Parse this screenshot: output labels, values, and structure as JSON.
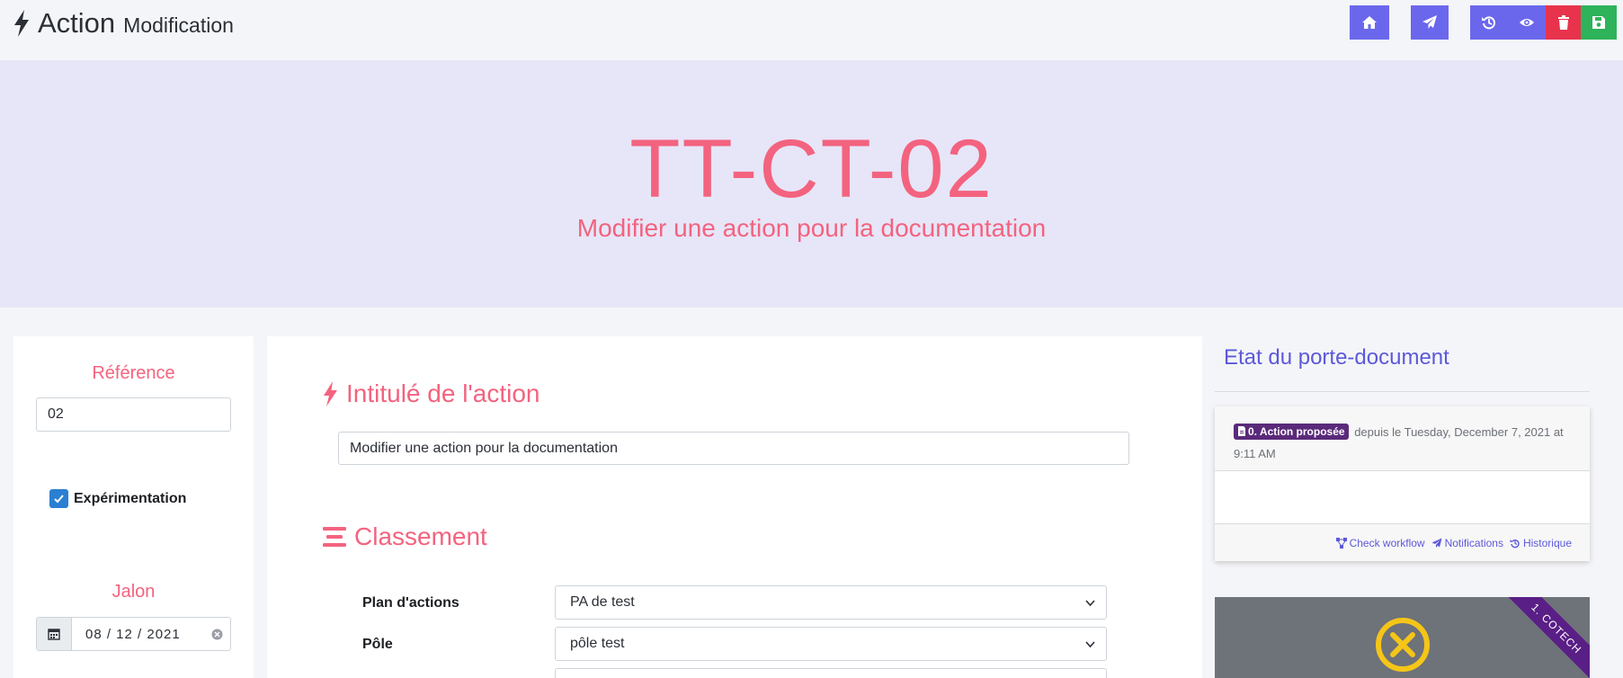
{
  "header": {
    "title": "Action",
    "subtitle": "Modification",
    "icons": [
      "bolt-icon",
      "home-icon",
      "paper-plane-icon",
      "history-icon",
      "eye-icon",
      "trash-icon",
      "save-icon"
    ]
  },
  "hero": {
    "code": "TT-CT-02",
    "subtitle": "Modifier une action pour la documentation"
  },
  "left": {
    "reference_label": "Référence",
    "reference_value": "02",
    "experimentation_label": "Expérimentation",
    "experimentation_checked": true,
    "jalon_label": "Jalon",
    "jalon_value": "08 / 12 / 2021"
  },
  "center": {
    "intitule_title": "Intitulé de l'action",
    "intitule_value": "Modifier une action pour la documentation",
    "classement_title": "Classement",
    "fields": [
      {
        "label": "Plan d'actions",
        "value": "PA de test"
      },
      {
        "label": "Pôle",
        "value": "pôle test"
      }
    ]
  },
  "right": {
    "title": "Etat du porte-document",
    "status_badge": "0. Action proposée",
    "status_text": "depuis le Tuesday, December 7, 2021 at 9:11 AM",
    "links": {
      "check_workflow": "Check workflow",
      "notifications": "Notifications",
      "historique": "Historique"
    },
    "ribbon": "1. COTECH"
  },
  "colors": {
    "accent_pink": "#f3637f",
    "accent_indigo": "#6b67ec",
    "danger": "#e8334d",
    "success": "#2eb35a",
    "hero_bg": "#e6e6f8",
    "badge_purple": "#5a2a7a"
  }
}
